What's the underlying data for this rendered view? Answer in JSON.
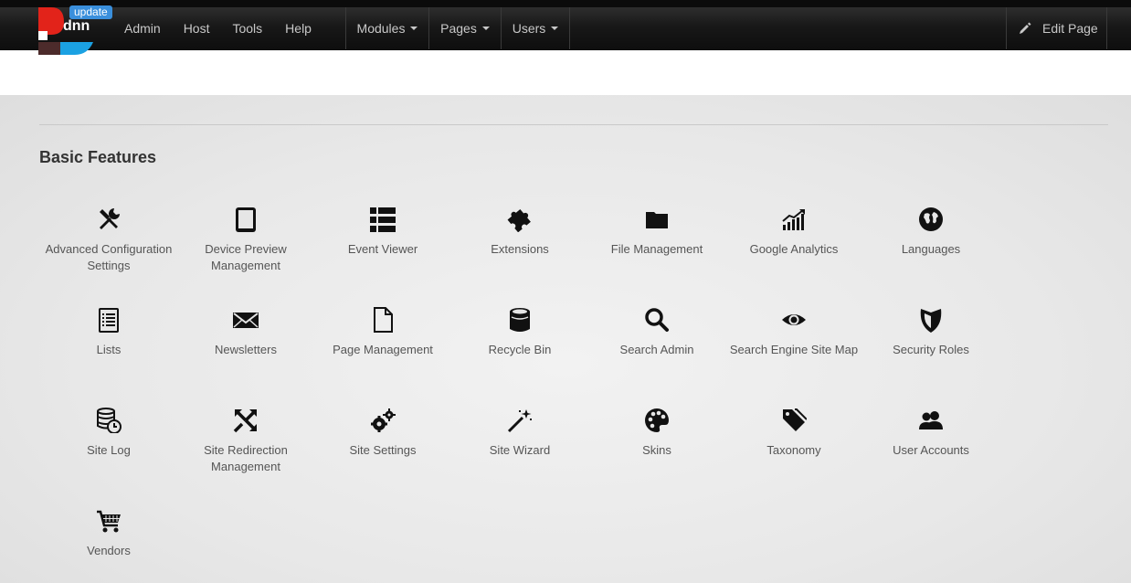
{
  "topbar": {
    "badge": "update",
    "nav_left": [
      "Admin",
      "Host",
      "Tools",
      "Help"
    ],
    "nav_mid": [
      {
        "label": "Modules"
      },
      {
        "label": "Pages"
      },
      {
        "label": "Users"
      }
    ],
    "edit_page": "Edit Page"
  },
  "colors": {
    "badge": "#3a8fdc",
    "logo_red": "#e2231a",
    "logo_blue": "#1ba1e2",
    "logo_dark": "#4c2b2b"
  },
  "section": {
    "title": "Basic Features",
    "items": [
      {
        "label": "Advanced Configuration Settings",
        "icon": "tools-icon"
      },
      {
        "label": "Device Preview Management",
        "icon": "tablet-icon"
      },
      {
        "label": "Event Viewer",
        "icon": "list-icon"
      },
      {
        "label": "Extensions",
        "icon": "puzzle-icon"
      },
      {
        "label": "File Management",
        "icon": "folder-icon"
      },
      {
        "label": "Google Analytics",
        "icon": "analytics-icon"
      },
      {
        "label": "Languages",
        "icon": "globe-icon"
      },
      {
        "label": "Lists",
        "icon": "document-list-icon"
      },
      {
        "label": "Newsletters",
        "icon": "envelope-icon"
      },
      {
        "label": "Page Management",
        "icon": "page-icon"
      },
      {
        "label": "Recycle Bin",
        "icon": "bin-icon"
      },
      {
        "label": "Search Admin",
        "icon": "search-icon"
      },
      {
        "label": "Search Engine Site Map",
        "icon": "eye-icon"
      },
      {
        "label": "Security Roles",
        "icon": "shield-icon"
      },
      {
        "label": "Site Log",
        "icon": "database-clock-icon"
      },
      {
        "label": "Site Redirection Management",
        "icon": "redirect-arrows-icon"
      },
      {
        "label": "Site Settings",
        "icon": "gears-icon"
      },
      {
        "label": "Site Wizard",
        "icon": "magic-wand-icon"
      },
      {
        "label": "Skins",
        "icon": "palette-icon"
      },
      {
        "label": "Taxonomy",
        "icon": "tags-icon"
      },
      {
        "label": "User Accounts",
        "icon": "users-icon"
      },
      {
        "label": "Vendors",
        "icon": "cart-icon"
      }
    ]
  }
}
